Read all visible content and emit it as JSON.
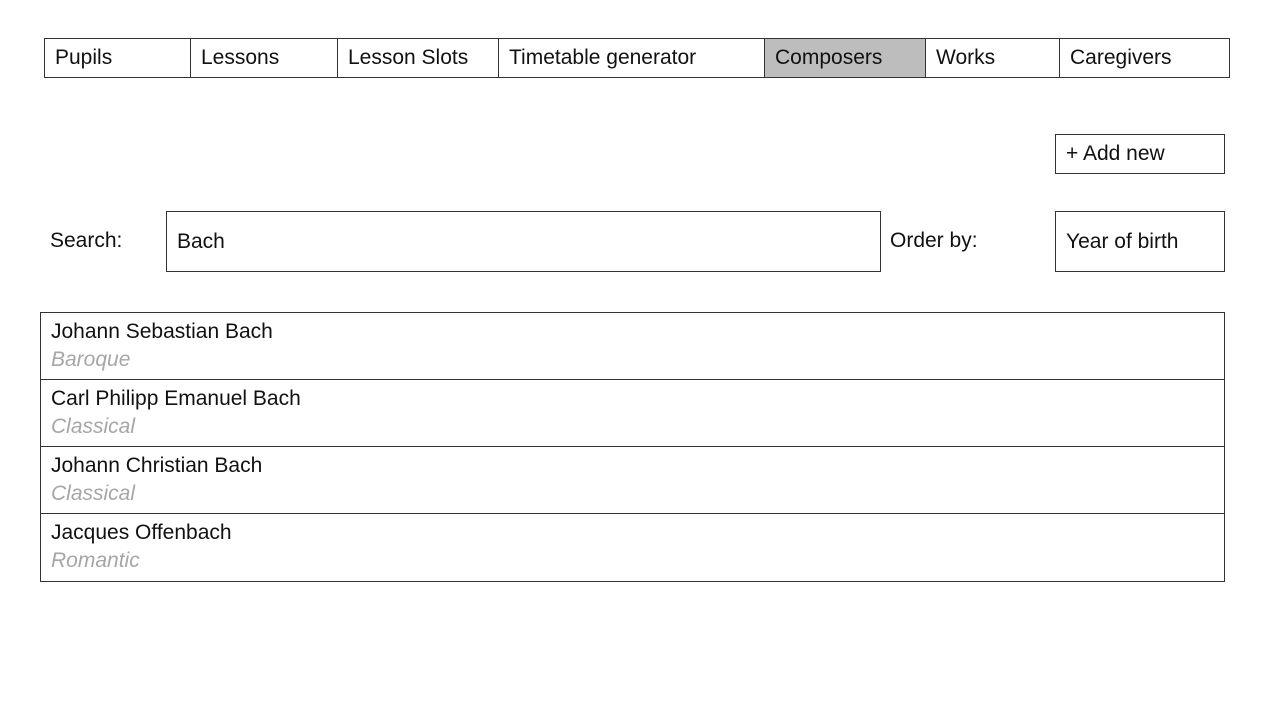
{
  "nav": {
    "tabs": [
      {
        "label": "Pupils"
      },
      {
        "label": "Lessons"
      },
      {
        "label": "Lesson Slots"
      },
      {
        "label": "Timetable generator"
      },
      {
        "label": "Composers",
        "active": true
      },
      {
        "label": "Works"
      },
      {
        "label": "Caregivers"
      }
    ]
  },
  "toolbar": {
    "add_new_label": "+ Add new"
  },
  "search": {
    "label": "Search:",
    "value": "Bach"
  },
  "order": {
    "label": "Order by:",
    "selected": "Year of birth"
  },
  "results": [
    {
      "name": "Johann Sebastian Bach",
      "era": "Baroque"
    },
    {
      "name": "Carl Philipp Emanuel Bach",
      "era": "Classical"
    },
    {
      "name": "Johann Christian Bach",
      "era": "Classical"
    },
    {
      "name": "Jacques Offenbach",
      "era": "Romantic"
    }
  ],
  "colors": {
    "active_tab": "#bdbdbd",
    "border": "#333333",
    "muted_text": "#a6a6a6"
  }
}
